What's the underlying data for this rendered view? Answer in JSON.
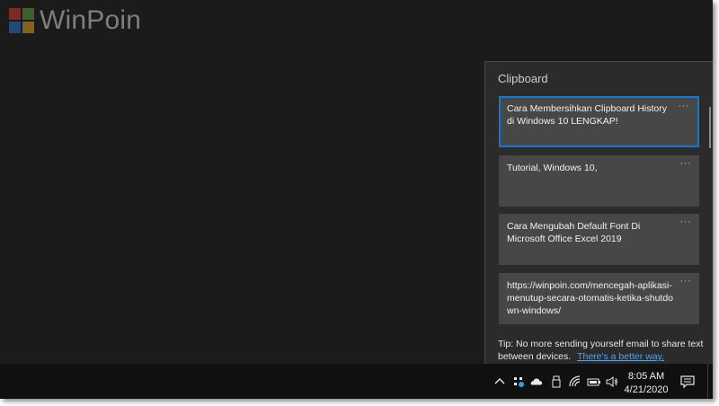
{
  "watermark": {
    "text": "WinPoin",
    "colors": [
      "#c93a2a",
      "#5a9a3a",
      "#2a6fc0",
      "#d0a020"
    ]
  },
  "clipboard": {
    "title": "Clipboard",
    "items": [
      {
        "text": "Cara Membersihkan Clipboard History di Windows 10 LENGKAP!",
        "more": "···",
        "selected": true
      },
      {
        "text": "Tutorial, Windows 10,",
        "more": "···",
        "selected": false
      },
      {
        "text": "Cara Mengubah Default Font Di Microsoft Office Excel 2019",
        "more": "···",
        "selected": false
      },
      {
        "text": "https://winpoin.com/mencegah-aplikasi-menutup-secara-otomatis-ketika-shutdown-windows/",
        "more": "···",
        "selected": false
      }
    ],
    "tip_text": "Tip: No more sending yourself email to share text between devices.",
    "tip_link": "There's a better way."
  },
  "taskbar": {
    "tray_icons": [
      "chevron-up-icon",
      "network-share-icon",
      "onedrive-cloud-icon",
      "usb-drive-icon",
      "wifi-icon",
      "battery-icon",
      "volume-icon"
    ],
    "time": "8:05 AM",
    "date": "4/21/2020",
    "action_center_icon": "notification-icon"
  },
  "colors": {
    "accent": "#1a73d1",
    "link": "#4aa3ff",
    "panel": "#2b2b2b",
    "item": "#474747",
    "taskbar": "#101010"
  }
}
